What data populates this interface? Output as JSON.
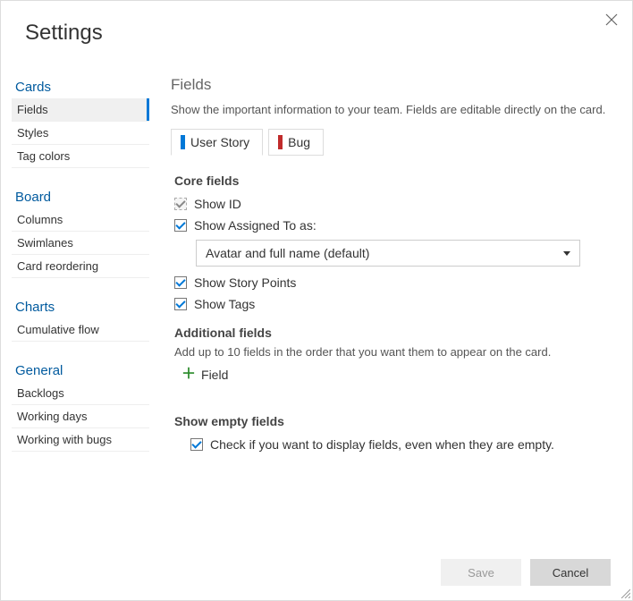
{
  "dialog": {
    "title": "Settings"
  },
  "sidebar": {
    "sections": [
      {
        "heading": "Cards",
        "items": [
          {
            "label": "Fields",
            "active": true
          },
          {
            "label": "Styles",
            "active": false
          },
          {
            "label": "Tag colors",
            "active": false
          }
        ]
      },
      {
        "heading": "Board",
        "items": [
          {
            "label": "Columns",
            "active": false
          },
          {
            "label": "Swimlanes",
            "active": false
          },
          {
            "label": "Card reordering",
            "active": false
          }
        ]
      },
      {
        "heading": "Charts",
        "items": [
          {
            "label": "Cumulative flow",
            "active": false
          }
        ]
      },
      {
        "heading": "General",
        "items": [
          {
            "label": "Backlogs",
            "active": false
          },
          {
            "label": "Working days",
            "active": false
          },
          {
            "label": "Working with bugs",
            "active": false
          }
        ]
      }
    ]
  },
  "page": {
    "heading": "Fields",
    "description": "Show the important information to your team. Fields are editable directly on the card."
  },
  "tabs": [
    {
      "label": "User Story",
      "color": "blue",
      "active": true
    },
    {
      "label": "Bug",
      "color": "red",
      "active": false
    }
  ],
  "core": {
    "heading": "Core fields",
    "show_id": {
      "label": "Show ID",
      "checked": true,
      "disabled": true
    },
    "show_assigned": {
      "label": "Show Assigned To as:",
      "checked": true
    },
    "assigned_select": {
      "value": "Avatar and full name (default)"
    },
    "show_story_points": {
      "label": "Show Story Points",
      "checked": true
    },
    "show_tags": {
      "label": "Show Tags",
      "checked": true
    }
  },
  "additional": {
    "heading": "Additional fields",
    "hint": "Add up to 10 fields in the order that you want them to appear on the card.",
    "add_label": "Field"
  },
  "empty": {
    "heading": "Show empty fields",
    "checkbox": {
      "label": "Check if you want to display fields, even when they are empty.",
      "checked": true
    }
  },
  "footer": {
    "save": "Save",
    "cancel": "Cancel"
  }
}
